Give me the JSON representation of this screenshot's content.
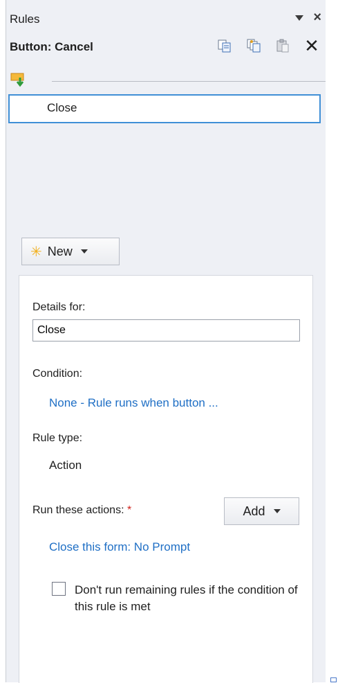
{
  "pane": {
    "title": "Rules",
    "control": "Button: Cancel",
    "toolbar_icons": [
      "copy-rule-icon",
      "copy-all-rules-icon",
      "paste-rule-icon",
      "delete-rule-icon"
    ]
  },
  "rules": [
    {
      "label": "Close"
    }
  ],
  "new_button": {
    "label": "New"
  },
  "details": {
    "details_for_label": "Details for:",
    "rule_name": "Close",
    "condition_label": "Condition:",
    "condition_link": "None - Rule runs when button ...",
    "rule_type_label": "Rule type:",
    "rule_type_value": "Action",
    "actions_label": "Run these actions:",
    "required_mark": "*",
    "add_button": "Add",
    "action_link": "Close this form: No Prompt",
    "stop_rules_text": "Don't run remaining rules if the condition of this rule is met"
  },
  "colors": {
    "pane_bg": "#eef0f5",
    "link": "#1f6fc5",
    "selection_border": "#3f8fd6",
    "required": "#d0221c"
  }
}
